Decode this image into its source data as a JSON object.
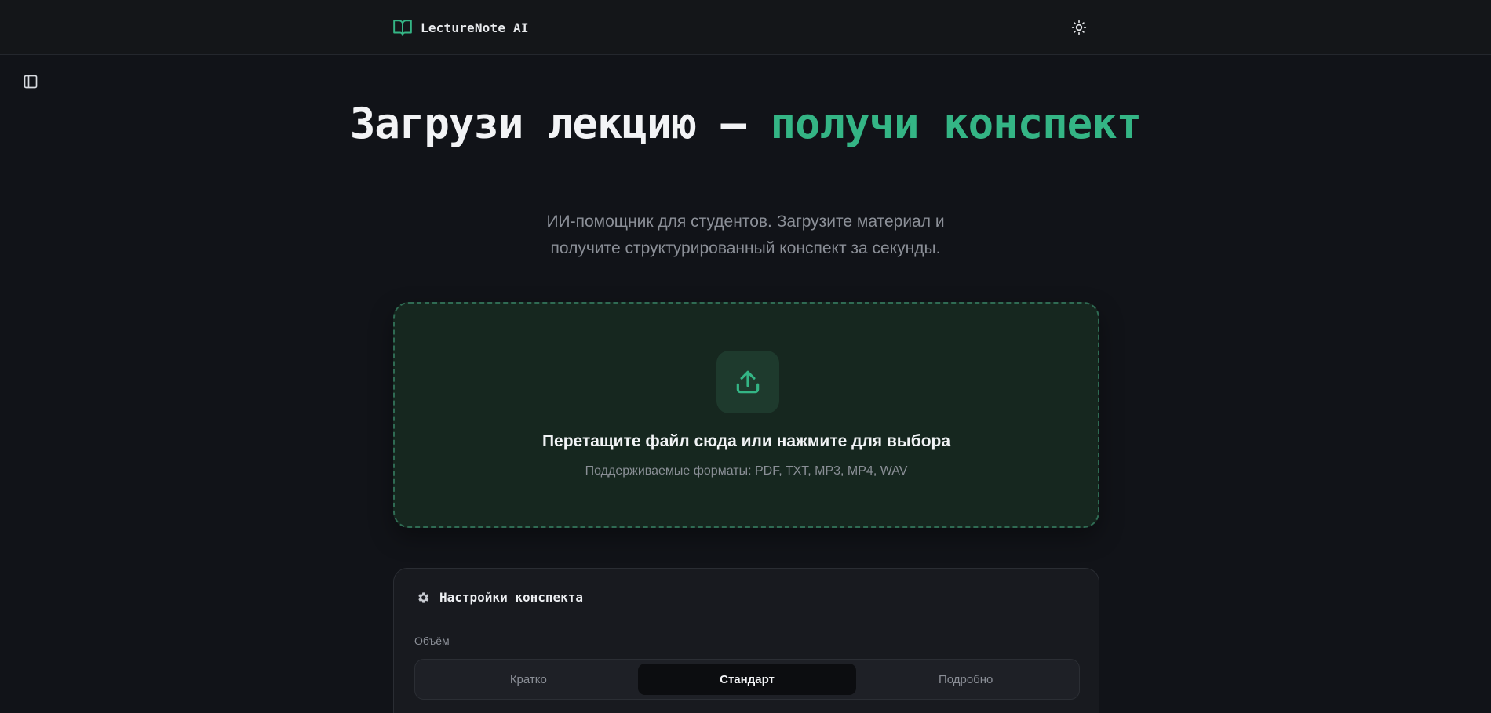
{
  "header": {
    "brand_name": "LectureNote AI",
    "brand_icon": "book-open-icon",
    "theme_icon": "sun-icon"
  },
  "sidebar": {
    "toggle_icon": "sidebar-panel-icon"
  },
  "hero": {
    "title_main": "Загрузи лекцию — ",
    "title_accent": "получи конспект",
    "subtitle": "ИИ-помощник для студентов. Загрузите материал и получите структурированный конспект за секунды."
  },
  "upload": {
    "icon": "upload-icon",
    "title": "Перетащите файл сюда или нажмите для выбора",
    "formats": "Поддерживаемые форматы: PDF, TXT, MP3, MP4, WAV"
  },
  "settings": {
    "icon": "gear-icon",
    "title": "Настройки конспекта",
    "volume_label": "Объём",
    "volume_options": [
      "Кратко",
      "Стандарт",
      "Подробно"
    ],
    "volume_selected": "Стандарт"
  },
  "colors": {
    "accent": "#34b585",
    "background": "#111318",
    "dropzone_bg": "#16271f"
  }
}
